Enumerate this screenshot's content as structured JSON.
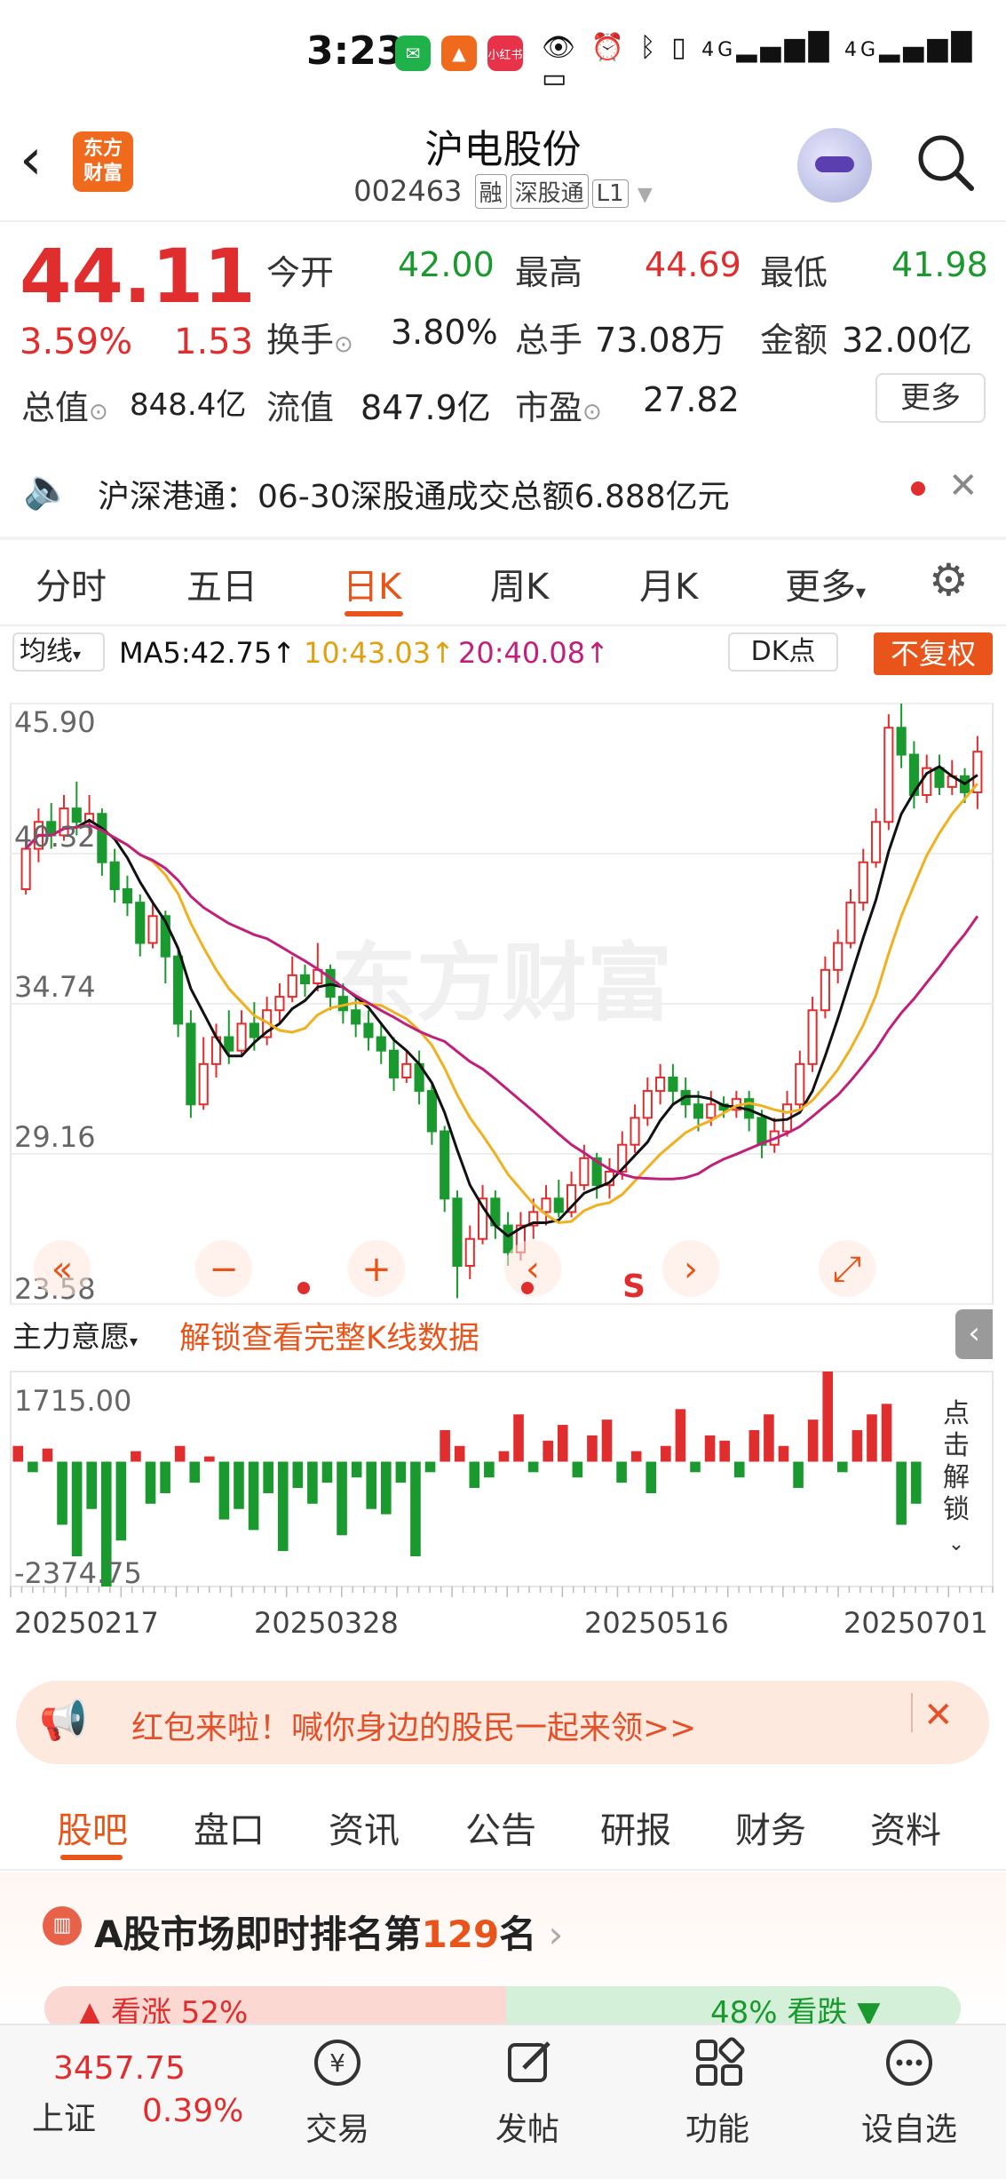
{
  "status_bar": {
    "time": "3:23",
    "network_1": "4G",
    "network_2": "4G"
  },
  "header": {
    "title": "沪电股份",
    "code": "002463",
    "tags": [
      "融",
      "深股通",
      "L1"
    ],
    "logo_line1": "东方",
    "logo_line2": "财富"
  },
  "quote": {
    "price": "44.11",
    "change_pct": "3.59%",
    "change": "1.53",
    "rows": [
      [
        {
          "label": "今开",
          "value": "42.00",
          "color": "green"
        },
        {
          "label": "最高",
          "value": "44.69",
          "color": "red"
        },
        {
          "label": "最低",
          "value": "41.98",
          "color": "green"
        }
      ],
      [
        {
          "label": "换手",
          "value": "3.80%",
          "color": "plain"
        },
        {
          "label": "总手",
          "value": "73.08万",
          "color": "plain"
        },
        {
          "label": "金额",
          "value": "32.00亿",
          "color": "plain"
        }
      ],
      [
        {
          "label": "总值",
          "value": "848.4亿",
          "color": "plain"
        },
        {
          "label": "流值",
          "value": "847.9亿",
          "color": "plain"
        },
        {
          "label": "市盈",
          "value": "27.82",
          "color": "plain"
        }
      ]
    ],
    "more_label": "更多"
  },
  "notice": {
    "text": "沪深港通：06-30深股通成交总额6.888亿元"
  },
  "period_tabs": [
    "分时",
    "五日",
    "日K",
    "周K",
    "月K",
    "更多"
  ],
  "active_period": "日K",
  "chart_toolbar": {
    "ma_selector": "均线",
    "ma5": "MA5:42.75↑",
    "ma10": "10:43.03↑",
    "ma20": "20:40.08↑",
    "dk_label": "DK点",
    "adjust_label": "不复权"
  },
  "indicator": {
    "name": "主力意愿",
    "unlock_text": "解锁查看完整K线数据",
    "side_label": "点击解锁"
  },
  "chart_data": {
    "type": "candlestick",
    "y_ticks": [
      "45.90",
      "40.32",
      "34.74",
      "29.16",
      "23.58"
    ],
    "ylim": [
      23.58,
      45.9
    ],
    "x_ticks": [
      "20250217",
      "20250328",
      "20250516",
      "20250701"
    ],
    "volume_ticks": [
      "1715.00",
      "-2374.75"
    ],
    "signal_label": "S",
    "watermark": "东方财富",
    "candles": [
      [
        39.0,
        40.5,
        38.8,
        41.0
      ],
      [
        40.5,
        41.5,
        40.0,
        42.0
      ],
      [
        41.5,
        41.0,
        40.5,
        42.2
      ],
      [
        41.0,
        42.0,
        40.8,
        42.5
      ],
      [
        42.0,
        41.5,
        41.0,
        43.0
      ],
      [
        41.5,
        41.8,
        41.0,
        42.5
      ],
      [
        41.8,
        40.0,
        39.5,
        42.0
      ],
      [
        40.0,
        39.0,
        38.5,
        40.5
      ],
      [
        39.0,
        38.5,
        38.0,
        39.5
      ],
      [
        38.5,
        37.0,
        36.5,
        38.8
      ],
      [
        37.0,
        38.0,
        36.8,
        38.5
      ],
      [
        38.0,
        36.5,
        35.5,
        38.2
      ],
      [
        36.5,
        34.0,
        33.5,
        36.8
      ],
      [
        34.0,
        31.0,
        30.5,
        34.5
      ],
      [
        31.0,
        32.5,
        30.8,
        33.5
      ],
      [
        32.5,
        33.5,
        32.0,
        34.0
      ],
      [
        33.5,
        33.0,
        32.5,
        34.5
      ],
      [
        33.0,
        34.0,
        32.8,
        34.5
      ],
      [
        34.0,
        33.5,
        33.0,
        34.8
      ],
      [
        33.5,
        34.5,
        33.2,
        35.0
      ],
      [
        34.5,
        35.0,
        34.0,
        35.5
      ],
      [
        35.0,
        35.8,
        34.8,
        36.5
      ],
      [
        35.8,
        35.5,
        35.0,
        36.2
      ],
      [
        35.5,
        36.0,
        35.2,
        37.0
      ],
      [
        36.0,
        35.0,
        34.5,
        36.2
      ],
      [
        35.0,
        34.5,
        34.0,
        35.5
      ],
      [
        34.5,
        34.0,
        33.5,
        35.0
      ],
      [
        34.0,
        33.5,
        33.0,
        34.5
      ],
      [
        33.5,
        33.0,
        32.5,
        34.0
      ],
      [
        33.0,
        32.0,
        31.5,
        33.5
      ],
      [
        32.0,
        32.5,
        31.8,
        33.0
      ],
      [
        32.5,
        31.5,
        31.0,
        33.0
      ],
      [
        31.5,
        30.0,
        29.5,
        31.8
      ],
      [
        30.0,
        27.5,
        27.0,
        30.2
      ],
      [
        27.5,
        25.0,
        23.8,
        27.8
      ],
      [
        25.0,
        26.0,
        24.5,
        26.5
      ],
      [
        26.0,
        27.5,
        25.8,
        28.0
      ],
      [
        27.5,
        26.5,
        26.0,
        27.8
      ],
      [
        26.5,
        25.5,
        25.0,
        27.0
      ],
      [
        25.5,
        26.5,
        25.2,
        27.0
      ],
      [
        26.5,
        27.0,
        26.0,
        27.5
      ],
      [
        27.0,
        27.5,
        26.5,
        28.0
      ],
      [
        27.5,
        27.0,
        26.8,
        28.2
      ],
      [
        27.0,
        28.0,
        26.8,
        28.5
      ],
      [
        28.0,
        29.0,
        27.8,
        29.5
      ],
      [
        29.0,
        28.0,
        27.5,
        29.2
      ],
      [
        28.0,
        28.5,
        27.5,
        29.0
      ],
      [
        28.5,
        29.5,
        28.2,
        30.0
      ],
      [
        29.5,
        30.5,
        29.2,
        31.0
      ],
      [
        30.5,
        31.5,
        30.2,
        32.0
      ],
      [
        31.5,
        32.0,
        31.0,
        32.5
      ],
      [
        32.0,
        31.5,
        31.0,
        32.5
      ],
      [
        31.5,
        31.0,
        30.5,
        32.0
      ],
      [
        31.0,
        30.5,
        30.0,
        31.5
      ],
      [
        30.5,
        31.0,
        30.2,
        31.5
      ],
      [
        31.0,
        30.8,
        30.5,
        31.3
      ],
      [
        30.8,
        31.2,
        30.5,
        31.5
      ],
      [
        31.2,
        30.5,
        30.0,
        31.5
      ],
      [
        30.5,
        29.5,
        29.0,
        30.8
      ],
      [
        29.5,
        30.0,
        29.2,
        30.5
      ],
      [
        30.0,
        31.0,
        29.8,
        31.5
      ],
      [
        31.0,
        32.5,
        30.8,
        33.0
      ],
      [
        32.5,
        34.5,
        32.2,
        35.0
      ],
      [
        34.5,
        36.0,
        34.2,
        36.5
      ],
      [
        36.0,
        37.0,
        35.5,
        37.5
      ],
      [
        37.0,
        38.5,
        36.8,
        39.0
      ],
      [
        38.5,
        40.0,
        38.2,
        40.5
      ],
      [
        40.0,
        41.5,
        39.8,
        42.0
      ],
      [
        41.5,
        45.0,
        41.2,
        45.5
      ],
      [
        45.0,
        44.0,
        43.5,
        45.9
      ],
      [
        44.0,
        42.5,
        42.0,
        44.5
      ],
      [
        42.5,
        43.5,
        42.2,
        44.0
      ],
      [
        43.5,
        42.8,
        42.5,
        44.0
      ],
      [
        42.8,
        43.2,
        42.5,
        43.8
      ],
      [
        43.2,
        42.6,
        42.2,
        43.5
      ],
      [
        42.6,
        44.11,
        41.98,
        44.69
      ]
    ],
    "volume": [
      300,
      -200,
      250,
      -1200,
      -1800,
      -900,
      -2374,
      -1500,
      200,
      -800,
      -600,
      300,
      -400,
      100,
      -1100,
      -900,
      -1300,
      -600,
      -1700,
      -500,
      -800,
      -400,
      -1400,
      -300,
      -900,
      -1000,
      -400,
      -1800,
      -200,
      600,
      300,
      -500,
      -300,
      200,
      900,
      -200,
      400,
      700,
      -300,
      500,
      800,
      -400,
      200,
      -600,
      300,
      1000,
      -200,
      500,
      400,
      -300,
      600,
      900,
      300,
      -500,
      800,
      1715,
      -200,
      600,
      900,
      1100,
      -1200,
      -800
    ]
  },
  "banner": {
    "text": "红包来啦！喊你身边的股民一起来领>>"
  },
  "bottom_tabs": [
    "股吧",
    "盘口",
    "资讯",
    "公告",
    "研报",
    "财务",
    "资料"
  ],
  "active_bottom_tab": "股吧",
  "rank": {
    "prefix": "A股市场即时排名第",
    "number": "129",
    "suffix": "名",
    "bull_label": "看涨 52%",
    "bear_label": "48% 看跌"
  },
  "bottom_nav": {
    "index_value": "3457.75",
    "index_name": "上证",
    "index_change": "0.39%",
    "items": [
      "交易",
      "发帖",
      "功能",
      "设自选"
    ]
  },
  "colors": {
    "up": "#e02d2d",
    "down": "#1a9a2e",
    "accent": "#e8541a",
    "ma5": "#111111",
    "ma10": "#f0b020",
    "ma20": "#c0207a"
  }
}
